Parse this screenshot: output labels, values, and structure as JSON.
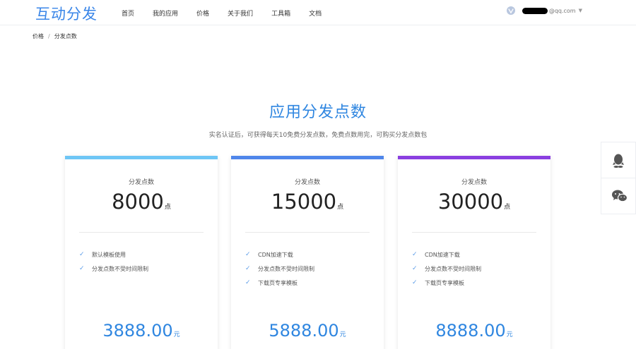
{
  "header": {
    "logo": "互动分发",
    "nav": [
      "首页",
      "我的应用",
      "价格",
      "关于我们",
      "工具箱",
      "文档"
    ],
    "user_email_suffix": "@qq.com",
    "vip_icon": "vip-badge-icon"
  },
  "breadcrumb": {
    "parent": "价格",
    "separator": "/",
    "current": "分发点数"
  },
  "hero": {
    "title": "应用分发点数",
    "subtitle": "实名认证后，可获得每天10免费分发点数，免费点数用完，可购买分发点数包"
  },
  "cards": [
    {
      "label": "分发点数",
      "points": "8000",
      "points_unit": "点",
      "accent": "#6ec6f5",
      "features": [
        "默认模板使用",
        "分发点数不受时间限制"
      ],
      "price": "3888.00",
      "price_unit": "元"
    },
    {
      "label": "分发点数",
      "points": "15000",
      "points_unit": "点",
      "accent": "#4f86ea",
      "features": [
        "CDN加速下载",
        "分发点数不受时间限制",
        "下载页专享模板"
      ],
      "price": "5888.00",
      "price_unit": "元"
    },
    {
      "label": "分发点数",
      "points": "30000",
      "points_unit": "点",
      "accent": "#8a3fe0",
      "features": [
        "CDN加速下载",
        "分发点数不受时间限制",
        "下载页专享模板"
      ],
      "price": "8888.00",
      "price_unit": "元"
    }
  ],
  "side_widgets": {
    "qq_icon": "qq-icon",
    "wechat_icon": "wechat-icon"
  },
  "colors": {
    "brand": "#3a86e8",
    "title": "#2f86e0",
    "check": "#5b9ce8"
  }
}
